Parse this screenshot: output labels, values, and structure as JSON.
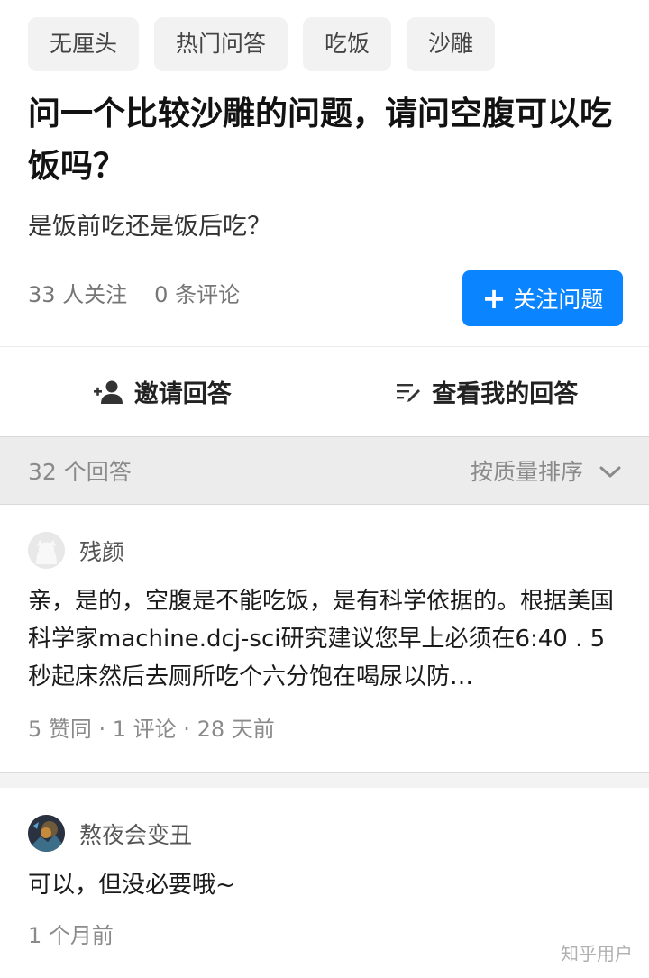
{
  "topics": [
    "无厘头",
    "热门问答",
    "吃饭",
    "沙雕"
  ],
  "question": {
    "title": "问一个比较沙雕的问题，请问空腹可以吃饭吗？",
    "detail": "是饭前吃还是饭后吃？",
    "followers": "33 人关注",
    "comments": "0 条评论",
    "follow_button": "关注问题"
  },
  "actions": {
    "invite": "邀请回答",
    "my_answer": "查看我的回答"
  },
  "answers_bar": {
    "count": "32 个回答",
    "sort": "按质量排序"
  },
  "answers": [
    {
      "author": "残颜",
      "content": "亲，是的，空腹是不能吃饭，是有科学依据的。根据美国科学家machine.dcj-sci研究建议您早上必须在6:40 .  5秒起床然后去厕所吃个六分饱在喝尿以防…",
      "meta": "5 赞同 · 1 评论 · 28 天前"
    },
    {
      "author": "熬夜会变丑",
      "content": "可以，但没必要哦~",
      "meta": "1 个月前"
    }
  ],
  "watermark": "知乎用户",
  "colors": {
    "accent": "#0a84ff",
    "topic_bg": "#f2f2f3",
    "sortbar_bg": "#ececec"
  }
}
